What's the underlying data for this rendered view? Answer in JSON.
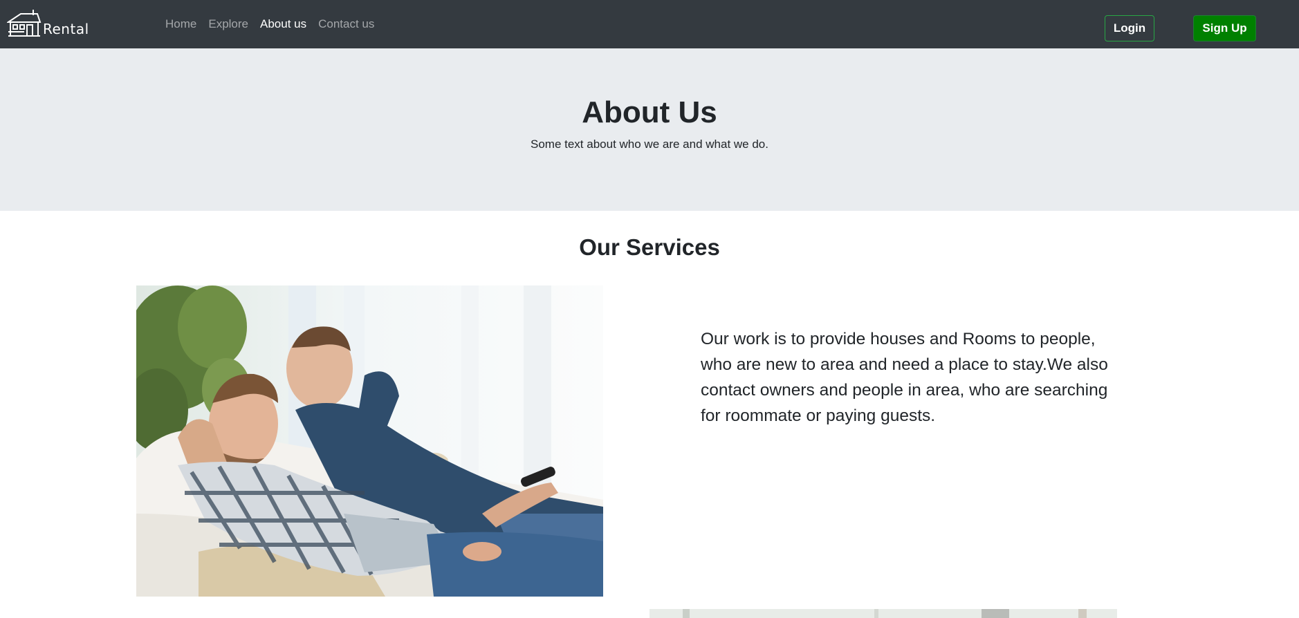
{
  "navbar": {
    "brand": {
      "icon": "house-icon",
      "text": "Rental"
    },
    "links": [
      {
        "label": "Home",
        "active": false
      },
      {
        "label": "Explore",
        "active": false
      },
      {
        "label": "About us",
        "active": true
      },
      {
        "label": "Contact us",
        "active": false
      }
    ],
    "login_label": "Login",
    "signup_label": "Sign Up"
  },
  "hero": {
    "title": "About Us",
    "subtitle": "Some text about who we are and what we do."
  },
  "services": {
    "title": "Our Services",
    "description": "Our work is to provide houses and Rooms to people, who are new to area and need a place to stay.We also contact owners and people in area, who are searching for roommate or paying guests."
  },
  "colors": {
    "navbar_bg": "#343a40",
    "hero_bg": "#e9ecef",
    "signup_bg": "#008000",
    "login_border": "#28a745"
  }
}
